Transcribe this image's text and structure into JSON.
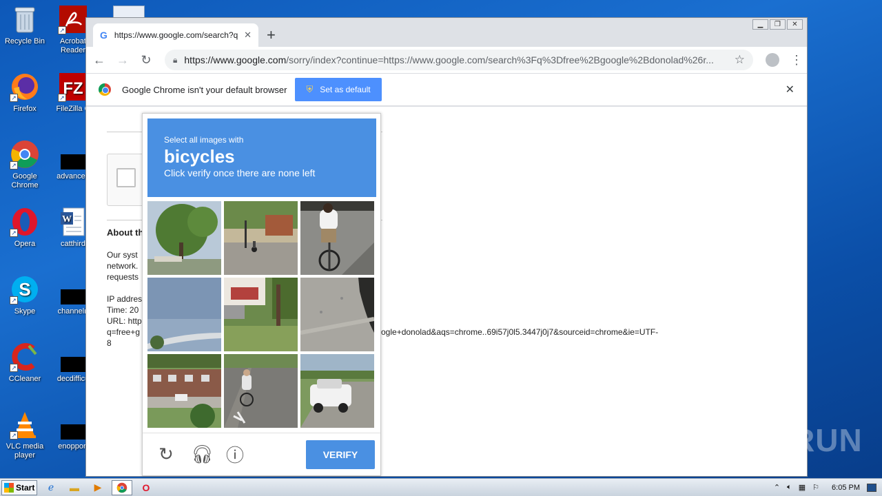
{
  "desktop": {
    "icons_col1": [
      {
        "label": "Recycle Bin",
        "icon": "recycle-bin-icon"
      },
      {
        "label": "Firefox",
        "icon": "firefox-icon"
      },
      {
        "label": "Google Chrome",
        "icon": "chrome-icon"
      },
      {
        "label": "Opera",
        "icon": "opera-icon"
      },
      {
        "label": "Skype",
        "icon": "skype-icon"
      },
      {
        "label": "CCleaner",
        "icon": "ccleaner-icon"
      },
      {
        "label": "VLC media player",
        "icon": "vlc-icon"
      }
    ],
    "icons_col2": [
      {
        "label": "Acrobat Reader",
        "icon": "acrobat-icon"
      },
      {
        "label": "FileZilla C",
        "icon": "filezilla-icon"
      },
      {
        "label": "advanced",
        "icon": "black-box"
      },
      {
        "label": "catthird",
        "icon": "word-icon"
      },
      {
        "label": "channelri",
        "icon": "black-box"
      },
      {
        "label": "decdifficu",
        "icon": "black-box"
      },
      {
        "label": "enopport",
        "icon": "black-box"
      }
    ]
  },
  "browser": {
    "tab_title": "https://www.google.com/search?q=",
    "url_domain": "https://www.google.com",
    "url_rest": "/sorry/index?continue=https://www.google.com/search%3Fq%3Dfree%2Bgoogle%2Bdonolad%26r...",
    "infobar_text": "Google Chrome isn't your default browser",
    "set_default_label": "Set as default"
  },
  "page": {
    "about_heading": "About th",
    "line1": "Our syst",
    "line2": "network.",
    "line3": "requests",
    "ip_line": "IP addres",
    "time_line": "Time: 20",
    "url_line": "URL: http",
    "url_cont": "q=free+g",
    "url_tail": "ogle+donolad&aqs=chrome..69i57j0l5.3447j0j7&sourceid=chrome&ie=UTF-",
    "url_end": "8"
  },
  "captcha": {
    "instruction": "Select all images with",
    "target": "bicycles",
    "subtext": "Click verify once there are none left",
    "verify_label": "VERIFY",
    "tiles": [
      "tree-street",
      "street-cyclist-far",
      "cyclist-closeup",
      "overpass-sky",
      "house-driveway",
      "road-asphalt",
      "motel-building",
      "cyclist-bike-lane",
      "white-suv"
    ]
  },
  "watermark": "ANY RUN",
  "taskbar": {
    "start_label": "Start",
    "clock": "6:05 PM"
  }
}
